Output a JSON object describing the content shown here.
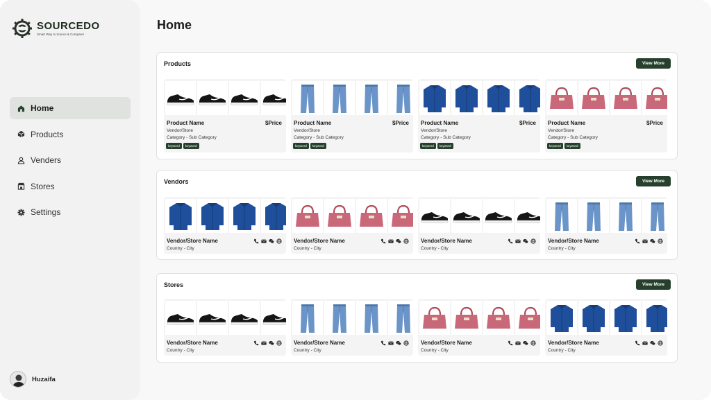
{
  "brand": {
    "name": "SOURCEDO",
    "tagline": "Smart Way to Source & Compare!"
  },
  "nav": [
    {
      "label": "Home",
      "icon": "home-icon",
      "active": true
    },
    {
      "label": "Products",
      "icon": "box-icon"
    },
    {
      "label": "Venders",
      "icon": "person-icon"
    },
    {
      "label": "Stores",
      "icon": "store-icon"
    },
    {
      "label": "Settings",
      "icon": "gear-icon"
    }
  ],
  "user": {
    "name": "Huzaifa"
  },
  "page": {
    "title": "Home"
  },
  "sections": {
    "products": {
      "title": "Products",
      "view_more": "View More",
      "cards": [
        {
          "thumb": "sneaker-icon",
          "name": "Product Name",
          "price": "$Price",
          "vendor": "Vendor/Store",
          "category": "Category - Sub Category",
          "tags": [
            "keyword",
            "keyword"
          ]
        },
        {
          "thumb": "jeans-icon",
          "name": "Product Name",
          "price": "$Price",
          "vendor": "Vendor/Store",
          "category": "Category - Sub Category",
          "tags": [
            "keyword",
            "keyword"
          ]
        },
        {
          "thumb": "shirt-icon",
          "name": "Product Name",
          "price": "$Price",
          "vendor": "Vendor/Store",
          "category": "Category - Sub Category",
          "tags": [
            "keyword",
            "keyword"
          ]
        },
        {
          "thumb": "handbag-icon",
          "name": "Product Name",
          "price": "$Price",
          "vendor": "Vendor/Store",
          "category": "Category - Sub Category",
          "tags": [
            "keyword",
            "keyword"
          ]
        }
      ]
    },
    "vendors": {
      "title": "Vendors",
      "view_more": "View More",
      "cards": [
        {
          "thumb": "shirt-icon",
          "name": "Vendor/Store Name",
          "location": "Country - City"
        },
        {
          "thumb": "handbag-icon",
          "name": "Vendor/Store Name",
          "location": "Country - City"
        },
        {
          "thumb": "sneaker-icon",
          "name": "Vendor/Store Name",
          "location": "Country - City"
        },
        {
          "thumb": "jeans-icon",
          "name": "Vendor/Store Name",
          "location": "Country - City"
        }
      ]
    },
    "stores": {
      "title": "Stores",
      "view_more": "View More",
      "cards": [
        {
          "thumb": "sneaker-icon",
          "name": "Vendor/Store Name",
          "location": "Country - City"
        },
        {
          "thumb": "jeans-icon",
          "name": "Vendor/Store Name",
          "location": "Country - City"
        },
        {
          "thumb": "handbag-icon",
          "name": "Vendor/Store Name",
          "location": "Country - City"
        },
        {
          "thumb": "shirt-icon",
          "name": "Vendor/Store Name",
          "location": "Country - City"
        }
      ]
    }
  },
  "colors": {
    "accent": "#26402d",
    "active_nav": "#dfe2df",
    "sidebar": "#f1f2f1",
    "background": "#f7f8f7"
  }
}
